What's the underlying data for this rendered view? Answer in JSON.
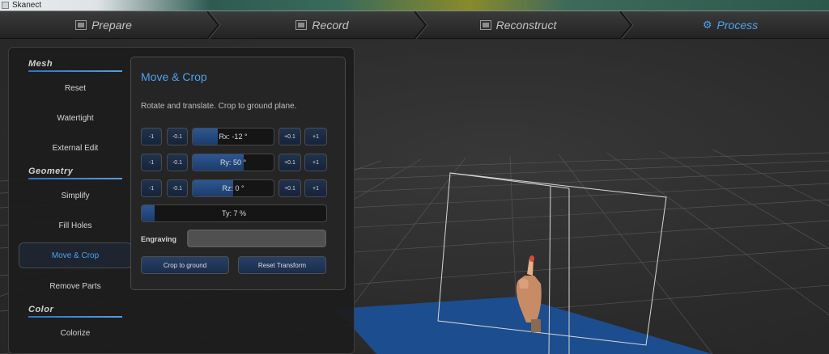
{
  "window": {
    "title": "Skanect"
  },
  "steps": [
    {
      "label": "Prepare"
    },
    {
      "label": "Record"
    },
    {
      "label": "Reconstruct"
    },
    {
      "label": "Process"
    }
  ],
  "sidebar": {
    "sections": [
      {
        "title": "Mesh",
        "items": [
          "Reset",
          "Watertight",
          "External Edit"
        ]
      },
      {
        "title": "Geometry",
        "items": [
          "Simplify",
          "Fill Holes",
          "Move & Crop",
          "Remove Parts"
        ]
      },
      {
        "title": "Color",
        "items": [
          "Colorize"
        ]
      }
    ],
    "selected_item": "Move & Crop"
  },
  "panel": {
    "title": "Move & Crop",
    "description": "Rotate and translate. Crop to ground plane.",
    "step_buttons": {
      "minus1": "-1",
      "minus01": "-0.1",
      "plus01": "+0.1",
      "plus1": "+1"
    },
    "rx": {
      "label": "Rx: -12 °",
      "fill": 0.31
    },
    "ry": {
      "label": "Ry: 50 °",
      "fill": 0.63
    },
    "rz": {
      "label": "Rz: 0 °",
      "fill": 0.5
    },
    "ty": {
      "label": "Ty: 7 %",
      "fill": 0.07
    },
    "engraving_label": "Engraving",
    "engraving_value": "",
    "crop_button": "Crop to ground",
    "reset_button": "Reset Transform"
  },
  "colors": {
    "accent": "#4aa2f0",
    "ground_plane": "#1b4f94",
    "button_fill": "#20324e"
  }
}
